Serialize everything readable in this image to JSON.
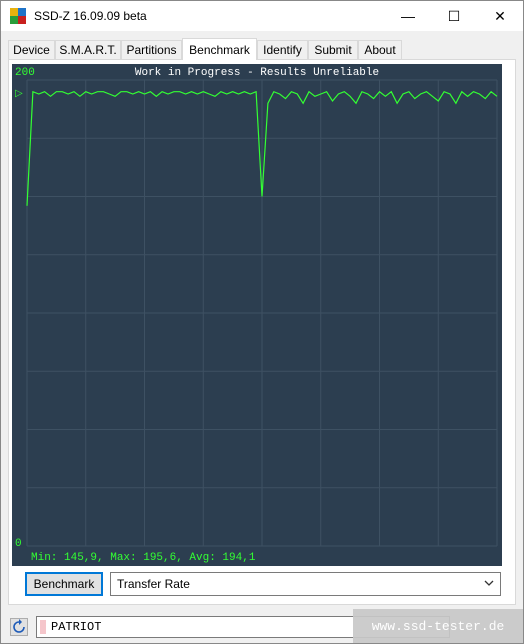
{
  "window": {
    "title": "SSD-Z 16.09.09 beta",
    "minimize_glyph": "—",
    "maximize_glyph": "☐",
    "close_glyph": "✕"
  },
  "tabs": [
    {
      "label": "Device"
    },
    {
      "label": "S.M.A.R.T."
    },
    {
      "label": "Partitions"
    },
    {
      "label": "Benchmark",
      "active": true
    },
    {
      "label": "Identify"
    },
    {
      "label": "Submit"
    },
    {
      "label": "About"
    }
  ],
  "chart": {
    "title": "Work in Progress - Results Unreliable",
    "y_max_label": "200",
    "y_min_label": "0",
    "stats": "Min: 145,9, Max: 195,6, Avg: 194,1",
    "marker_glyph": "▷",
    "line_color": "#33ff33",
    "bg_color": "#2c3e50",
    "grid_color": "#3e5163"
  },
  "chart_data": {
    "type": "line",
    "ylim": [
      0,
      200
    ],
    "grid": true,
    "series": [
      {
        "values": [
          146,
          195,
          194,
          195,
          193,
          195,
          195,
          194,
          195,
          193,
          195,
          194,
          195,
          195,
          194,
          193,
          195,
          195,
          194,
          195,
          194,
          195,
          193,
          195,
          194,
          195,
          195,
          194,
          195,
          194,
          195,
          194,
          193,
          195,
          194,
          195,
          194,
          195,
          194,
          195,
          150,
          190,
          195,
          194,
          192,
          195,
          194,
          190,
          195,
          193,
          194,
          195,
          191,
          194,
          195,
          193,
          190,
          195,
          194,
          192,
          195,
          193,
          195,
          190,
          194,
          195,
          192,
          194,
          195,
          193,
          191,
          195,
          194,
          190,
          195,
          193,
          195,
          194,
          192,
          195,
          193
        ]
      }
    ]
  },
  "controls": {
    "benchmark_button": "Benchmark",
    "mode_select": "Transfer Rate"
  },
  "status": {
    "drive_name": "PATRIOT",
    "watermark": "www.ssd-tester.de"
  },
  "icons": {
    "app": "ssd-z-app-icon",
    "refresh": "refresh-icon",
    "dropdown": "chevron-down-icon"
  }
}
